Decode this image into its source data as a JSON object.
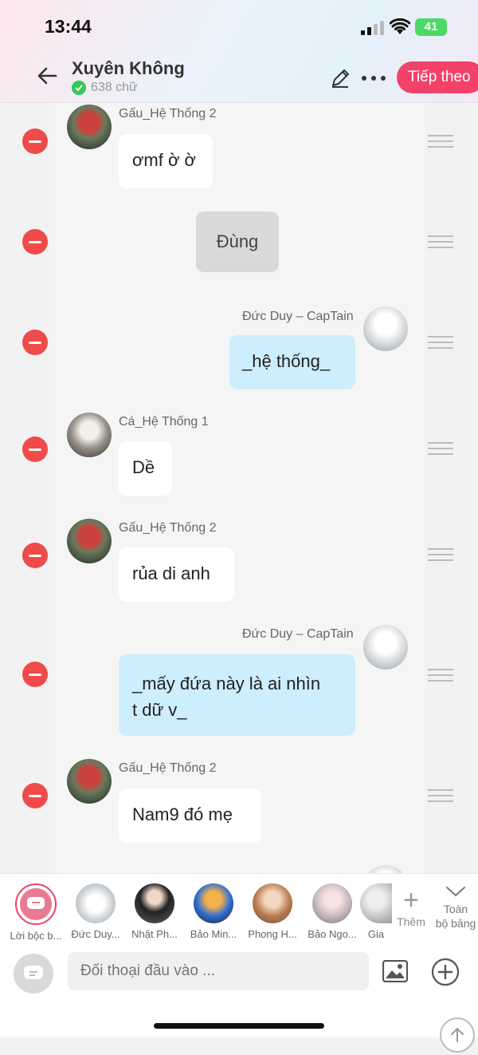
{
  "status_bar": {
    "time": "13:44",
    "battery": "41"
  },
  "header": {
    "title": "Xuyên Không",
    "word_count": "638 chữ",
    "next_label": "Tiếp theo"
  },
  "messages": [
    {
      "type": "left",
      "name": "Gấu_Hệ Thống 2",
      "text": "ơmf ờ ờ"
    },
    {
      "type": "narration",
      "text": "Đùng"
    },
    {
      "type": "right",
      "name": "Đức Duy – CapTain",
      "text": "_hệ thống_"
    },
    {
      "type": "left",
      "name": "Cá_Hệ Thống 1",
      "text": "Dề"
    },
    {
      "type": "left",
      "name": "Gấu_Hệ Thống 2",
      "text": "rủa di anh"
    },
    {
      "type": "right",
      "name": "Đức Duy – CapTain",
      "text_line1": "_mấy đứa này là ai nhìn",
      "text_line2": "t dữ v_"
    },
    {
      "type": "left",
      "name": "Gấu_Hệ Thống 2",
      "text": "Nam9 đó mẹ"
    }
  ],
  "characters": [
    {
      "label": "Lời bộc b..."
    },
    {
      "label": "Đức Duy..."
    },
    {
      "label": "Nhật Ph..."
    },
    {
      "label": "Bảo Min..."
    },
    {
      "label": "Phong H..."
    },
    {
      "label": "Bảo Ngo..."
    },
    {
      "label": "Gia"
    }
  ],
  "panel": {
    "add_label": "Thêm",
    "collapse_label_1": "Toàn",
    "collapse_label_2": "bộ bảng",
    "input_placeholder": "Đối thoại đầu vào ..."
  },
  "colors": {
    "accent": "#f2426a",
    "delete": "#f04a4a",
    "bubble_self": "#cdeefc",
    "verified": "#34c759"
  },
  "icons": [
    "back-arrow-icon",
    "checkmark-icon",
    "pencil-icon",
    "more-dots-icon",
    "minus-icon",
    "drag-handle-icon",
    "chevron-down-icon",
    "plus-icon",
    "image-icon",
    "add-circle-icon",
    "chat-bubble-icon",
    "arrow-up-icon"
  ]
}
